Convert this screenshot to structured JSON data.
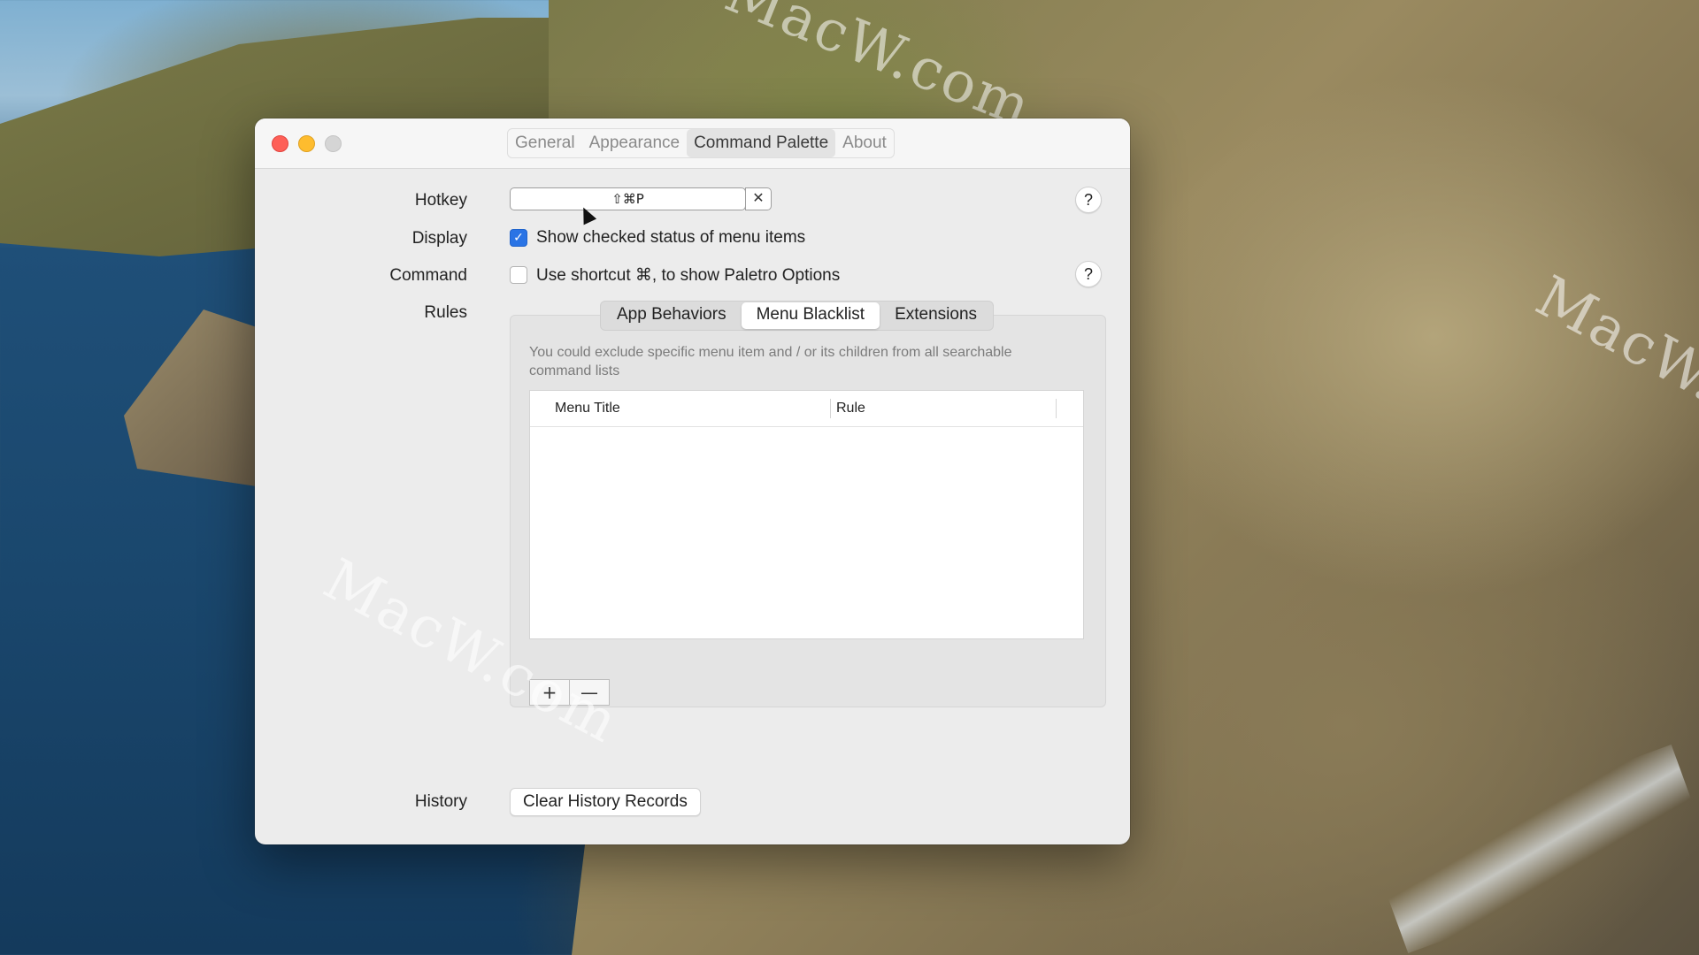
{
  "window": {
    "tabs": [
      "General",
      "Appearance",
      "Command Palette",
      "About"
    ],
    "active_tab": "Command Palette"
  },
  "hotkey": {
    "label": "Hotkey",
    "value": "⇧⌘P",
    "clear_glyph": "✕"
  },
  "display": {
    "label": "Display",
    "checkbox_label": "Show checked status of menu items",
    "checked": true
  },
  "command": {
    "label": "Command",
    "checkbox_label": "Use shortcut ⌘, to show Paletro Options",
    "checked": false
  },
  "rules": {
    "label": "Rules",
    "tabs": [
      "App Behaviors",
      "Menu Blacklist",
      "Extensions"
    ],
    "active_tab": "Menu Blacklist",
    "description": "You could exclude specific menu item and / or its children from all searchable command lists",
    "table": {
      "columns": [
        "Menu Title",
        "Rule"
      ],
      "rows": []
    },
    "add_glyph": "+",
    "remove_glyph": "—"
  },
  "history": {
    "label": "History",
    "button_label": "Clear History Records"
  },
  "help_glyph": "?",
  "watermark": "MacW.com",
  "colors": {
    "accent": "#2a74e5",
    "close": "#fe5f57",
    "minimize": "#febc2e",
    "zoom_disabled": "#d5d5d5"
  }
}
